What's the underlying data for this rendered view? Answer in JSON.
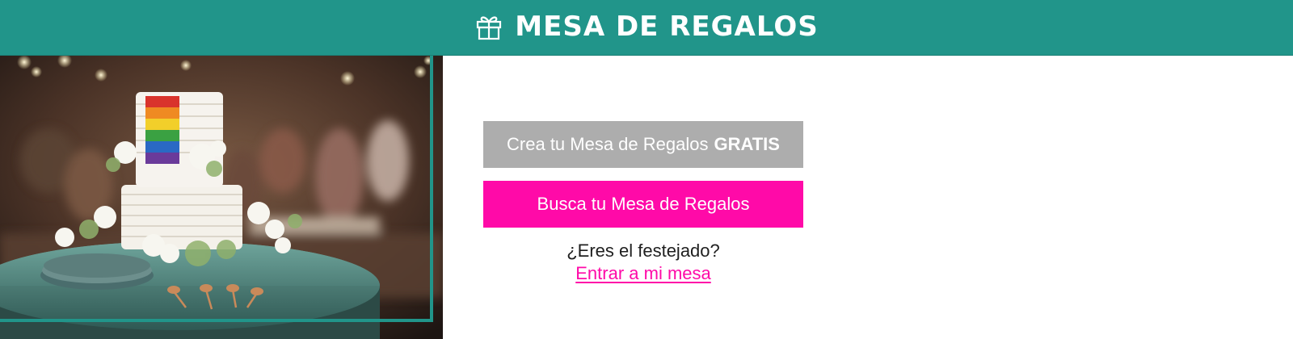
{
  "header": {
    "title": "MESA DE REGALOS",
    "icon": "gift-icon",
    "background": "#21958a"
  },
  "photo": {
    "subject": "wedding-cake-photo"
  },
  "actions": {
    "create_label": "Crea tu Mesa de Regalos",
    "create_label_strong": "GRATIS",
    "search_label": "Busca tu Mesa de Regalos",
    "question": "¿Eres el festejado?",
    "enter_link": "Entrar a mi mesa"
  },
  "colors": {
    "accent": "#21958a",
    "primary_button": "#ff0aa8",
    "secondary_button": "#adadad"
  }
}
